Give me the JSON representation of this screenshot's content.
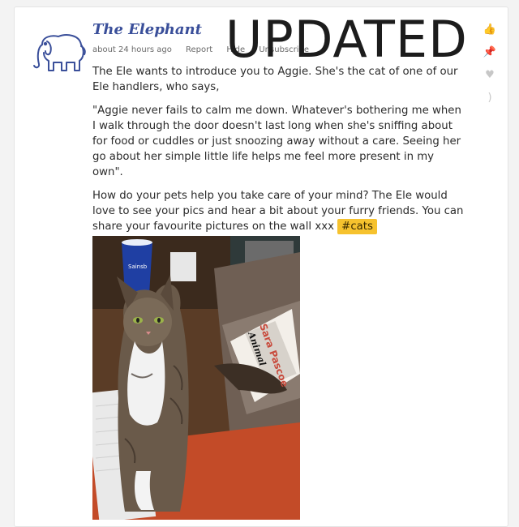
{
  "post": {
    "author": "The Elephant",
    "meta": {
      "time": "about 24 hours ago",
      "report": "Report",
      "hide": "Hide",
      "unsubscribe": "Unsubscribe"
    },
    "overlay_text": "UPDATED",
    "paragraphs": [
      "The Ele wants to introduce you to Aggie. She's the cat of one of our Ele handlers, who says,",
      "\"Aggie never fails to calm me down. Whatever's bothering me when I walk through the door doesn't last long when she's sniffing about for food or cuddles or just snoozing away without a care. Seeing her go about her simple little life helps me feel more present in my own\".",
      "How do your pets help you take care of your mind? The Ele would love to see your pics and hear a bit about your furry friends. You can share your favourite pictures on the wall xxx"
    ],
    "hashtag": "#cats",
    "image_text": {
      "cup_text": "Sainsb",
      "book_author": "Sara Pascoe",
      "book_title": "Animal"
    }
  },
  "actions": [
    {
      "name": "like-icon",
      "glyph": "👍"
    },
    {
      "name": "pin-icon",
      "glyph": "📌"
    },
    {
      "name": "heart-icon",
      "glyph": "♥"
    },
    {
      "name": "hug-icon",
      "glyph": ")"
    }
  ],
  "colors": {
    "accent": "#3a4f9a",
    "hashtag_bg": "#f6c22e",
    "icon_gray": "#c7c7c7"
  }
}
